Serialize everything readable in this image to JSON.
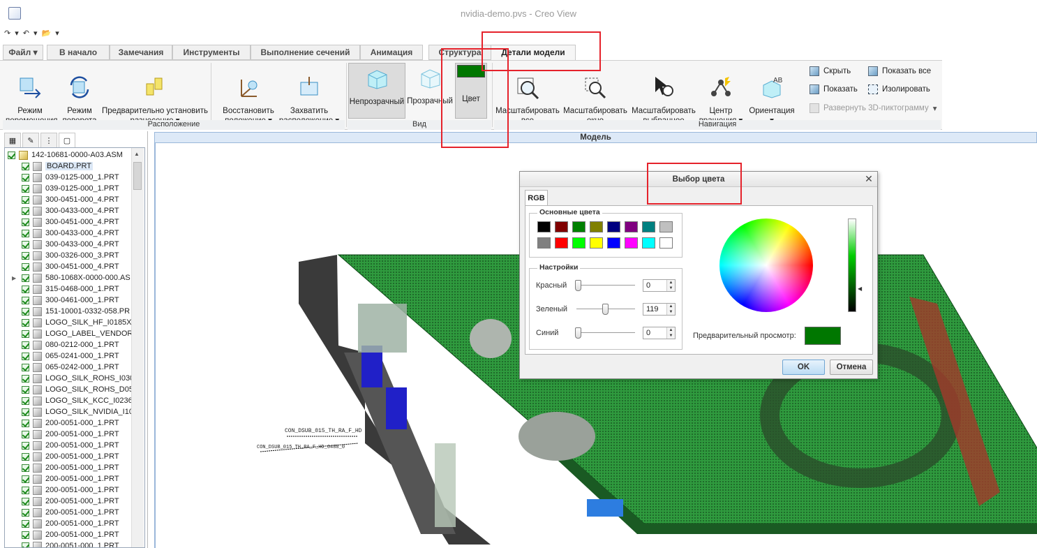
{
  "window": {
    "title": "nvidia-demo.pvs - Creo View"
  },
  "qat": {
    "redo": "↷",
    "undo": "↶",
    "open": "📂",
    "more": "▾"
  },
  "tabs": {
    "file": "Файл ▾",
    "home": "В начало",
    "markup": "Замечания",
    "tools": "Инструменты",
    "sections": "Выполнение сечений",
    "animation": "Анимация",
    "structure": "Структура",
    "model_details": "Детали модели"
  },
  "ribbon": {
    "pan_mode": "Режим\nперемещения",
    "rotate_mode": "Режим\nповорота",
    "preset_explode": "Предварительно установить\nразнесение ▾",
    "restore_position": "Восстановить\nположение ▾",
    "capture_location": "Захватить\nрасположение ▾",
    "opaque": "Непрозрачный",
    "transparent": "Прозрачный",
    "color": "Цвет",
    "zoom_all": "Масштабировать\nвсе",
    "zoom_window": "Масштабировать\nокно",
    "zoom_selected": "Масштабировать\nвыбранное",
    "spin_center": "Центр\nвращения ▾",
    "orientation": "Ориентация\n▾",
    "hide": "Скрыть",
    "show": "Показать",
    "show_all": "Показать все",
    "isolate": "Изолировать",
    "expand_3d": "Развернуть 3D-пиктограмму",
    "group_layout": "Расположение",
    "group_view": "Вид",
    "group_nav": "Навигация"
  },
  "tree": {
    "items": [
      "142-10681-0000-A03.ASM",
      "BOARD.PRT",
      "039-0125-000_1.PRT",
      "039-0125-000_1.PRT",
      "300-0451-000_4.PRT",
      "300-0433-000_4.PRT",
      "300-0451-000_4.PRT",
      "300-0433-000_4.PRT",
      "300-0433-000_4.PRT",
      "300-0326-000_3.PRT",
      "300-0451-000_4.PRT",
      "580-1068X-0000-000.AS",
      "315-0468-000_1.PRT",
      "300-0461-000_1.PRT",
      "151-10001-0332-058.PR",
      "LOGO_SILK_HF_I0185X",
      "LOGO_LABEL_VENDOR",
      "080-0212-000_1.PRT",
      "065-0241-000_1.PRT",
      "065-0242-000_1.PRT",
      "LOGO_SILK_ROHS_I030",
      "LOGO_SILK_ROHS_D05",
      "LOGO_SILK_KCC_I0236",
      "LOGO_SILK_NVIDIA_I10",
      "200-0051-000_1.PRT",
      "200-0051-000_1.PRT",
      "200-0051-000_1.PRT",
      "200-0051-000_1.PRT",
      "200-0051-000_1.PRT",
      "200-0051-000_1.PRT",
      "200-0051-000_1.PRT",
      "200-0051-000_1.PRT",
      "200-0051-000_1.PRT",
      "200-0051-000_1.PRT",
      "200-0051-000_1.PRT",
      "200-0051-000_1.PRT"
    ]
  },
  "model": {
    "header": "Модель",
    "label1": "CON_DSUB_015_TH_RA_F_HD",
    "label2": "CON_DSUB_015_TH_RA_F_HD_0488_0"
  },
  "dialog": {
    "title": "Выбор цвета",
    "tab": "RGB",
    "basic_colors_label": "Основные цвета",
    "basic_colors": [
      "#000000",
      "#800000",
      "#008000",
      "#808000",
      "#000080",
      "#800080",
      "#008080",
      "#c0c0c0",
      "#808080",
      "#ff0000",
      "#00ff00",
      "#ffff00",
      "#0000ff",
      "#ff00ff",
      "#00ffff",
      "#ffffff"
    ],
    "settings_label": "Настройки",
    "red_label": "Красный",
    "green_label": "Зеленый",
    "blue_label": "Синий",
    "red_value": "0",
    "green_value": "119",
    "blue_value": "0",
    "red_fraction": 0,
    "green_fraction": 0.4667,
    "blue_fraction": 0,
    "preview_label": "Предварительный просмотр:",
    "preview_color": "#007700",
    "ok": "OK",
    "cancel": "Отмена"
  }
}
